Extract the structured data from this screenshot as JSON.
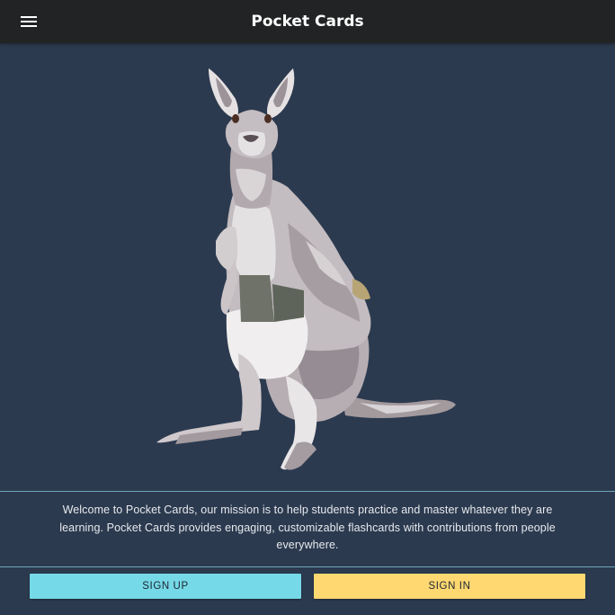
{
  "app": {
    "title": "Pocket Cards"
  },
  "header": {
    "menu_icon": "hamburger-menu-icon"
  },
  "hero": {
    "illustration": "kangaroo-illustration"
  },
  "welcome": {
    "text": "Welcome to Pocket Cards, our mission is to help students practice and master whatever they are learning. Pocket Cards provides engaging, customizable flashcards with contributions from people everywhere."
  },
  "actions": {
    "signup_label": "SIGN UP",
    "signin_label": "SIGN IN"
  },
  "colors": {
    "background": "#2c3a4f",
    "app_bar": "#222324",
    "signup": "#76d9e7",
    "signin": "#ffd871",
    "divider": "#6fa7b8"
  }
}
